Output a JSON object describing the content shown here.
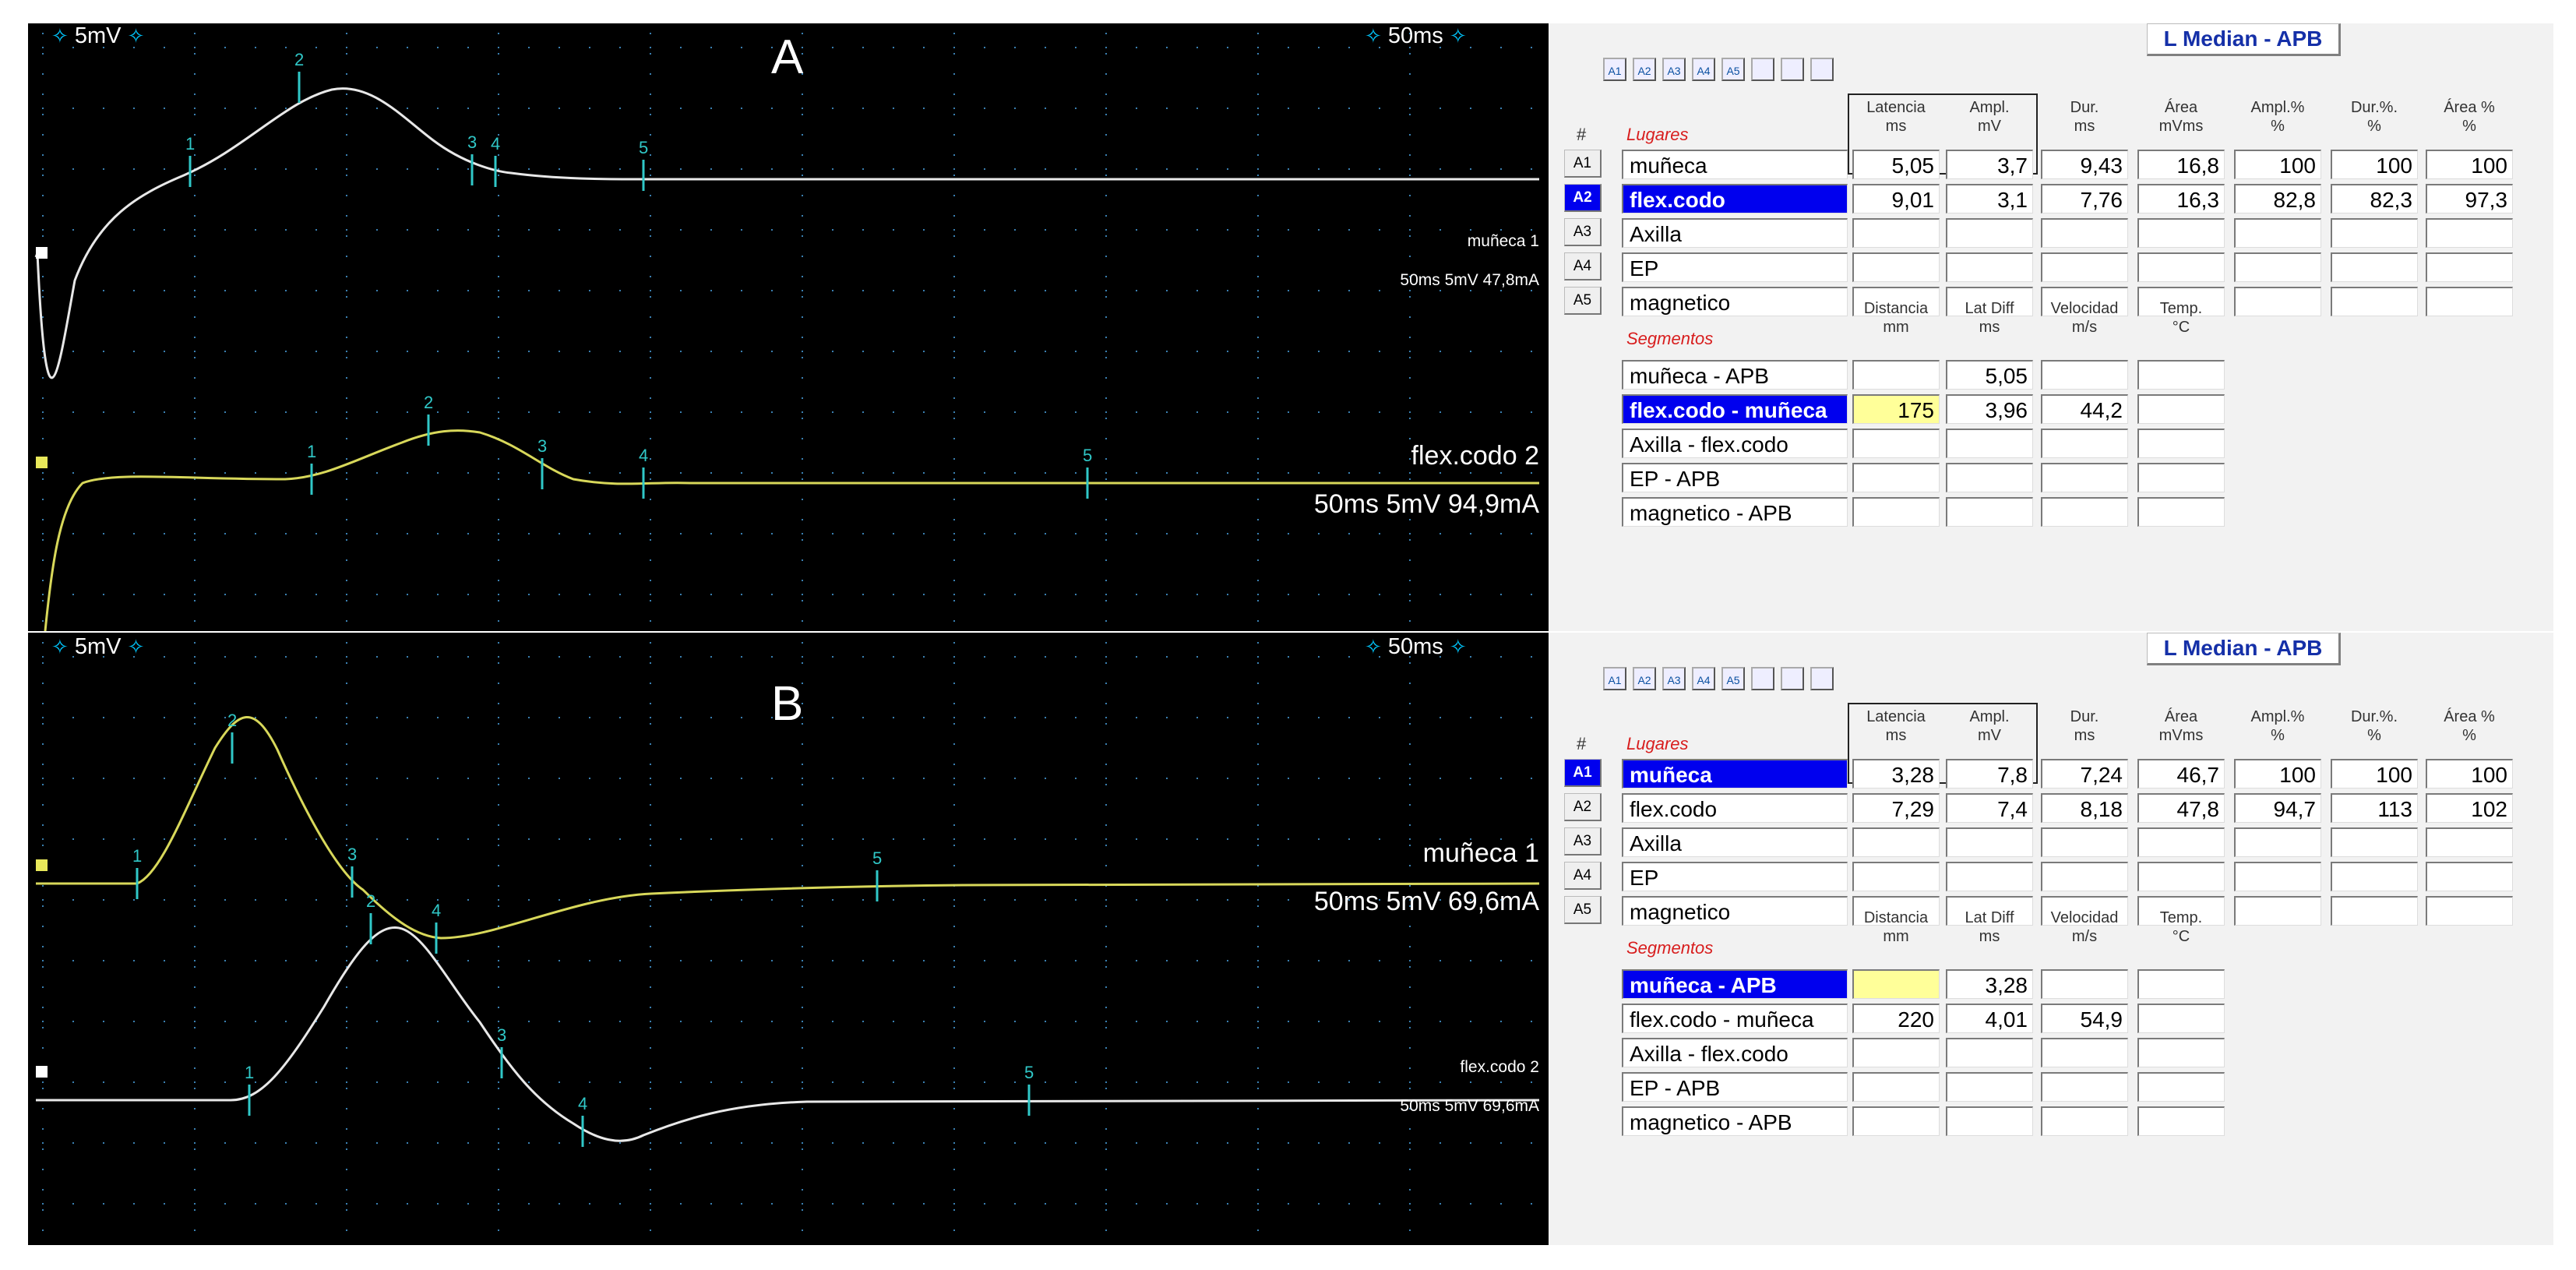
{
  "panelA": {
    "letter": "A",
    "sens_left": "5mV",
    "sens_right": "50ms",
    "trace1": {
      "label1": "muñeca 1",
      "label2": "50ms 5mV 47,8mA",
      "color": "#e8e8e8"
    },
    "trace2": {
      "label1": "flex.codo 2",
      "label2": "50ms 5mV 94,9mA",
      "color": "#d8d85a"
    }
  },
  "panelB": {
    "letter": "B",
    "sens_left": "5mV",
    "sens_right": "50ms",
    "trace1": {
      "label1": "muñeca 1",
      "label2": "50ms 5mV 69,6mA",
      "color": "#d8d85a"
    },
    "trace2": {
      "label1": "flex.codo 2",
      "label2": "50ms 5mV 69,6mA",
      "color": "#e8e8e8"
    }
  },
  "marker_numbers": [
    "1",
    "2",
    "3",
    "4",
    "5"
  ],
  "tables": [
    {
      "title": "L Median - APB",
      "buttons": [
        "A1",
        "A2",
        "A3",
        "A4",
        "A5",
        "",
        "",
        ""
      ],
      "hash": "#",
      "lugares_label": "Lugares",
      "col_headers": [
        {
          "l1": "Latencia",
          "l2": "ms"
        },
        {
          "l1": "Ampl.",
          "l2": "mV"
        },
        {
          "l1": "Dur.",
          "l2": "ms"
        },
        {
          "l1": "Área",
          "l2": "mVms"
        },
        {
          "l1": "Ampl.%",
          "l2": "%"
        },
        {
          "l1": "Dur.%.",
          "l2": "%"
        },
        {
          "l1": "Área %",
          "l2": "%"
        }
      ],
      "rows": [
        {
          "id": "A1",
          "site": "muñeca",
          "vals": [
            "5,05",
            "3,7",
            "9,43",
            "16,8",
            "100",
            "100",
            "100"
          ],
          "sel": false
        },
        {
          "id": "A2",
          "site": "flex.codo",
          "vals": [
            "9,01",
            "3,1",
            "7,76",
            "16,3",
            "82,8",
            "82,3",
            "97,3"
          ],
          "sel": true
        },
        {
          "id": "A3",
          "site": "Axilla",
          "vals": [
            "",
            "",
            "",
            "",
            "",
            "",
            ""
          ],
          "sel": false
        },
        {
          "id": "A4",
          "site": "EP",
          "vals": [
            "",
            "",
            "",
            "",
            "",
            "",
            ""
          ],
          "sel": false
        },
        {
          "id": "A5",
          "site": "magnetico",
          "vals": [
            "",
            "",
            "",
            "",
            "",
            "",
            ""
          ],
          "sel": false
        }
      ],
      "seg_label": "Segmentos",
      "seg_headers": [
        {
          "l1": "Distancia",
          "l2": "mm"
        },
        {
          "l1": "Lat Diff",
          "l2": "ms"
        },
        {
          "l1": "Velocidad",
          "l2": "m/s"
        },
        {
          "l1": "Temp.",
          "l2": "°C"
        }
      ],
      "segs": [
        {
          "name": "muñeca - APB",
          "vals": [
            "",
            "5,05",
            "",
            ""
          ],
          "sel": false,
          "yellow": false
        },
        {
          "name": "flex.codo - muñeca",
          "vals": [
            "175",
            "3,96",
            "44,2",
            ""
          ],
          "sel": true,
          "yellow": true
        },
        {
          "name": "Axilla - flex.codo",
          "vals": [
            "",
            "",
            "",
            ""
          ],
          "sel": false,
          "yellow": false
        },
        {
          "name": "EP - APB",
          "vals": [
            "",
            "",
            "",
            ""
          ],
          "sel": false,
          "yellow": false
        },
        {
          "name": "magnetico - APB",
          "vals": [
            "",
            "",
            "",
            ""
          ],
          "sel": false,
          "yellow": false
        }
      ]
    },
    {
      "title": "L Median - APB",
      "buttons": [
        "A1",
        "A2",
        "A3",
        "A4",
        "A5",
        "",
        "",
        ""
      ],
      "hash": "#",
      "lugares_label": "Lugares",
      "col_headers": [
        {
          "l1": "Latencia",
          "l2": "ms"
        },
        {
          "l1": "Ampl.",
          "l2": "mV"
        },
        {
          "l1": "Dur.",
          "l2": "ms"
        },
        {
          "l1": "Área",
          "l2": "mVms"
        },
        {
          "l1": "Ampl.%",
          "l2": "%"
        },
        {
          "l1": "Dur.%.",
          "l2": "%"
        },
        {
          "l1": "Área %",
          "l2": "%"
        }
      ],
      "rows": [
        {
          "id": "A1",
          "site": "muñeca",
          "vals": [
            "3,28",
            "7,8",
            "7,24",
            "46,7",
            "100",
            "100",
            "100"
          ],
          "sel": true
        },
        {
          "id": "A2",
          "site": "flex.codo",
          "vals": [
            "7,29",
            "7,4",
            "8,18",
            "47,8",
            "94,7",
            "113",
            "102"
          ],
          "sel": false
        },
        {
          "id": "A3",
          "site": "Axilla",
          "vals": [
            "",
            "",
            "",
            "",
            "",
            "",
            ""
          ],
          "sel": false
        },
        {
          "id": "A4",
          "site": "EP",
          "vals": [
            "",
            "",
            "",
            "",
            "",
            "",
            ""
          ],
          "sel": false
        },
        {
          "id": "A5",
          "site": "magnetico",
          "vals": [
            "",
            "",
            "",
            "",
            "",
            "",
            ""
          ],
          "sel": false
        }
      ],
      "seg_label": "Segmentos",
      "seg_headers": [
        {
          "l1": "Distancia",
          "l2": "mm"
        },
        {
          "l1": "Lat Diff",
          "l2": "ms"
        },
        {
          "l1": "Velocidad",
          "l2": "m/s"
        },
        {
          "l1": "Temp.",
          "l2": "°C"
        }
      ],
      "segs": [
        {
          "name": "muñeca - APB",
          "vals": [
            "",
            "3,28",
            "",
            ""
          ],
          "sel": true,
          "yellow": true
        },
        {
          "name": "flex.codo - muñeca",
          "vals": [
            "220",
            "4,01",
            "54,9",
            ""
          ],
          "sel": false,
          "yellow": false
        },
        {
          "name": "Axilla - flex.codo",
          "vals": [
            "",
            "",
            "",
            ""
          ],
          "sel": false,
          "yellow": false
        },
        {
          "name": "EP - APB",
          "vals": [
            "",
            "",
            "",
            ""
          ],
          "sel": false,
          "yellow": false
        },
        {
          "name": "magnetico - APB",
          "vals": [
            "",
            "",
            "",
            ""
          ],
          "sel": false,
          "yellow": false
        }
      ]
    }
  ]
}
